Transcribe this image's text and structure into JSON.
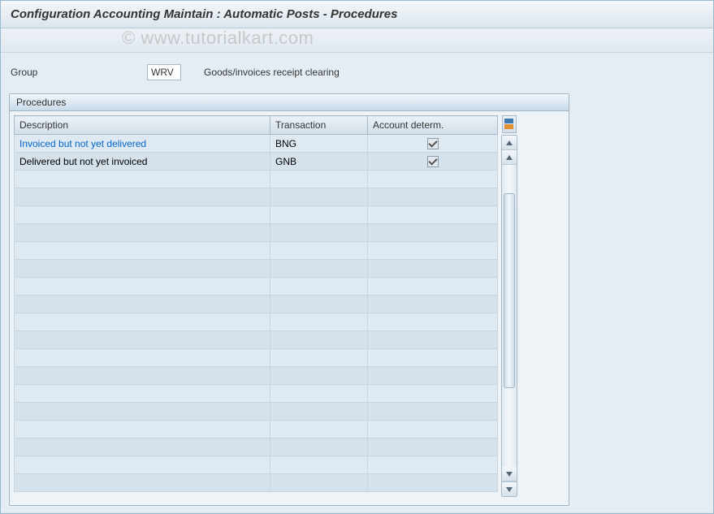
{
  "title": "Configuration Accounting Maintain : Automatic Posts - Procedures",
  "watermark": "© www.tutorialkart.com",
  "group": {
    "label": "Group",
    "value": "WRV",
    "description": "Goods/invoices receipt clearing"
  },
  "panel": {
    "title": "Procedures",
    "columns": {
      "description": "Description",
      "transaction": "Transaction",
      "account_determ": "Account determ."
    },
    "rows": [
      {
        "description": "Invoiced but not yet delivered",
        "transaction": "BNG",
        "account_determ": true,
        "is_link": true
      },
      {
        "description": "Delivered but not yet invoiced",
        "transaction": "GNB",
        "account_determ": true,
        "is_link": false
      }
    ],
    "empty_row_count": 18
  }
}
